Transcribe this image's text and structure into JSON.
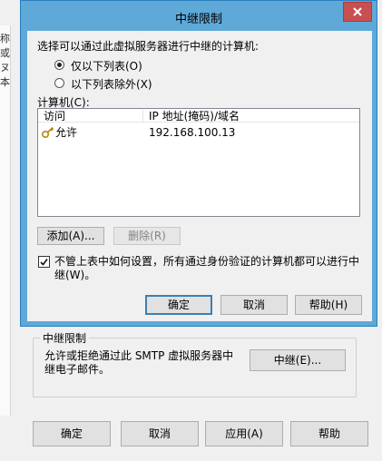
{
  "parent": {
    "left_strip": [
      "称",
      "或",
      "ヌ",
      "本"
    ],
    "group_legend": "中继限制",
    "group_desc": "允许或拒绝通过此 SMTP 虚拟服务器中继电子邮件。",
    "relay_button": "中继(E)...",
    "buttons": {
      "ok": "确定",
      "cancel": "取消",
      "apply": "应用(A)",
      "help": "帮助"
    }
  },
  "dialog": {
    "title": "中继限制",
    "prompt": "选择可以通过此虚拟服务器进行中继的计算机:",
    "radio_only": "仅以下列表(O)",
    "radio_except": "以下列表除外(X)",
    "computers_label": "计算机(C):",
    "columns": [
      "访问",
      "IP 地址(掩码)/域名"
    ],
    "rows": [
      {
        "access": "允许",
        "address": "192.168.100.13"
      }
    ],
    "add_button": "添加(A)...",
    "remove_button": "删除(R)",
    "checkbox_text": "不管上表中如何设置，所有通过身份验证的计算机都可以进行中继(W)。",
    "checkbox_checked": true,
    "ok": "确定",
    "cancel": "取消",
    "help": "帮助(H)"
  },
  "colors": {
    "title_bar": "#5ea9d8",
    "close_button": "#c75050",
    "default_button_border": "#3c7fb1"
  },
  "icons": {
    "close": "close-icon",
    "row": "key-icon",
    "check": "checkmark-icon"
  }
}
